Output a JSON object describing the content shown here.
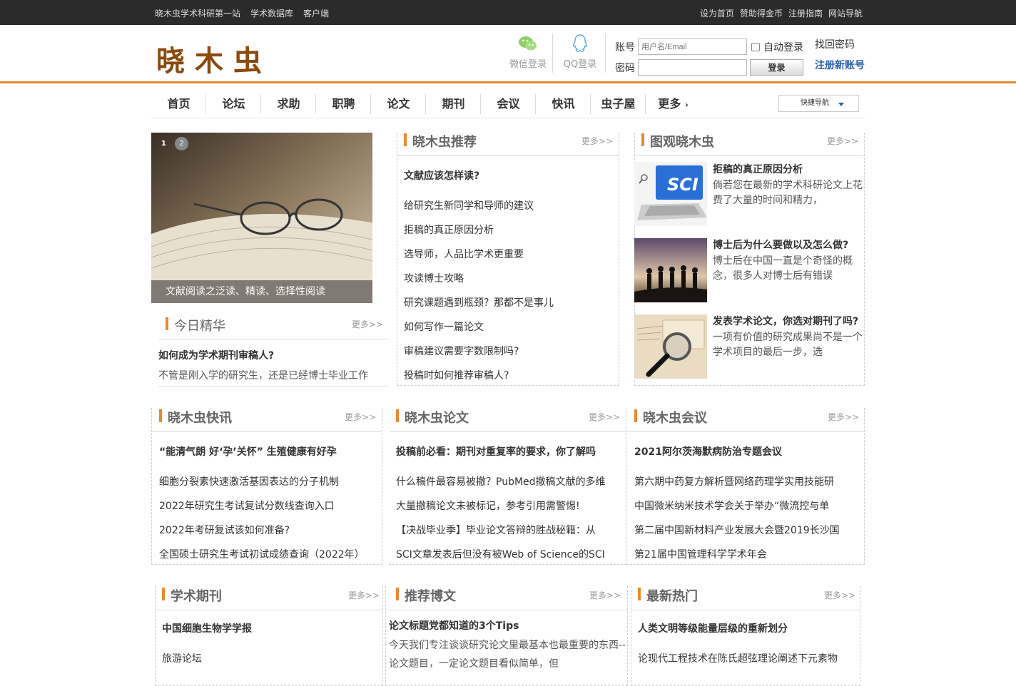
{
  "topbar": {
    "left": [
      "晓木虫学术科研第一站",
      "学术数据库",
      "客户端"
    ],
    "right": [
      "设为首页",
      "赞助得金币",
      "注册指南",
      "网站导航"
    ]
  },
  "logo": {
    "text": "晓木虫"
  },
  "sso": {
    "wechat": "微信登录",
    "qq": "QQ登录"
  },
  "login": {
    "account_label": "账号",
    "account_placeholder": "用户名/Email",
    "password_label": "密码",
    "auto_login": "自动登录",
    "login_button": "登录",
    "find_password": "找回密码",
    "register": "注册新账号"
  },
  "nav": {
    "items": [
      "首页",
      "论坛",
      "求助",
      "职聘",
      "论文",
      "期刊",
      "会议",
      "快讯",
      "虫子屋",
      "更多"
    ],
    "more_arrow": "›",
    "quick": "快捷导航"
  },
  "slider": {
    "dot1": "1",
    "dot2": "2",
    "caption": "文献阅读之泛读、精读、选择性阅读"
  },
  "today": {
    "title": "今日精华",
    "more": "更多>>",
    "item_title": "如何成为学术期刊审稿人?",
    "item_desc": "不管是刚入学的研究生，还是已经博士毕业工作"
  },
  "recommend": {
    "title": "晓木虫推荐",
    "more": "更多>>",
    "items": [
      "文献应该怎样读?",
      "给研究生新同学和导师的建议",
      "拒稿的真正原因分析",
      "选导师，人品比学术更重要",
      "攻读博士攻略",
      "研究课题遇到瓶颈？那都不是事儿",
      "如何写作一篇论文",
      "审稿建议需要字数限制吗?",
      "投稿时如何推荐审稿人?"
    ]
  },
  "visual": {
    "title": "图观晓木虫",
    "more": "更多>>",
    "items": [
      {
        "title": "拒稿的真正原因分析",
        "desc": "倘若您在最新的学术科研论文上花费了大量的时间和精力，"
      },
      {
        "title": "博士后为什么要做以及怎么做?",
        "desc": "博士后在中国一直是个奇怪的概念，很多人对博士后有错误"
      },
      {
        "title": "发表学术论文，你选对期刊了吗?",
        "desc": "一项有价值的研究成果尚不是一个学术项目的最后一步，选"
      }
    ]
  },
  "news": {
    "title": "晓木虫快讯",
    "more": "更多>>",
    "items": [
      "“能清气朗 好‘孕’关怀” 生殖健康有好孕",
      "细胞分裂素快速激活基因表达的分子机制",
      "2022年研究生考试复试分数线查询入口",
      "2022年考研复试该如何准备?",
      "全国硕士研究生考试初试成绩查询（2022年）"
    ]
  },
  "papers": {
    "title": "晓木虫论文",
    "more": "更多>>",
    "items": [
      "投稿前必看：期刊对重复率的要求，你了解吗",
      "什么稿件最容易被撤？PubMed撤稿文献的多维",
      "大量撤稿论文未被标记，参考引用需警惕!",
      "【决战毕业季】毕业论文答辩的胜战秘籍：从",
      "SCI文章发表后但没有被Web of Science的SCI"
    ]
  },
  "conference": {
    "title": "晓木虫会议",
    "more": "更多>>",
    "items": [
      "2021阿尔茨海默病防治专题会议",
      "第六期中药复方解析暨网络药理学实用技能研",
      "中国微米纳米技术学会关于举办“微流控与单",
      "第二届中国新材料产业发展大会暨2019长沙国",
      "第21届中国管理科学学术年会"
    ]
  },
  "journals": {
    "title": "学术期刊",
    "more": "更多>>",
    "items": [
      "中国细胞生物学学报",
      "旅游论坛"
    ]
  },
  "blogs": {
    "title": "推荐博文",
    "more": "更多>>",
    "item_title": "论文标题党都知道的3个Tips",
    "item_desc": "今天我们专注谈谈研究论文里最基本也最重要的东西--",
    "item_desc2": "论文题目，一定论文题目看似简单，但"
  },
  "hot": {
    "title": "最新热门",
    "more": "更多>>",
    "items": [
      "人类文明等级能量层级的重新划分",
      "论现代工程技术在陈氏超弦理论阐述下元素物"
    ]
  },
  "colors": {
    "accent": "#e8892f",
    "topbar": "#2b2b2b",
    "link": "#2a5db0",
    "logo": "#8a4a0c"
  }
}
